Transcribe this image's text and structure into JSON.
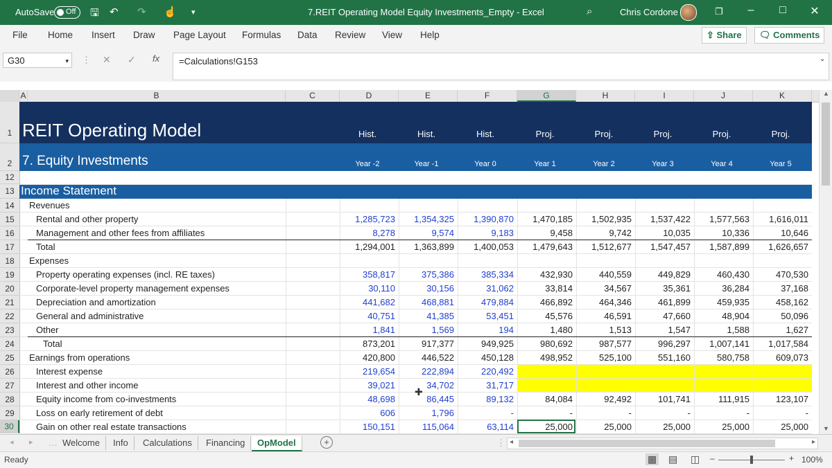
{
  "titlebar": {
    "autosave": "AutoSave",
    "autosave_state": "Off",
    "filename": "7.REIT Operating Model Equity Investments_Empty  -  Excel",
    "user": "Chris Cordone"
  },
  "ribbon": {
    "tabs": [
      "File",
      "Home",
      "Insert",
      "Draw",
      "Page Layout",
      "Formulas",
      "Data",
      "Review",
      "View",
      "Help"
    ],
    "share": "Share",
    "comments": "Comments"
  },
  "formula_bar": {
    "name_box": "G30",
    "formula": "=Calculations!G153",
    "fx": "fx"
  },
  "columns": [
    "A",
    "B",
    "C",
    "D",
    "E",
    "F",
    "G",
    "H",
    "I",
    "J",
    "K"
  ],
  "row_numbers": [
    "1",
    "2",
    "12",
    "13",
    "14",
    "15",
    "16",
    "17",
    "18",
    "19",
    "20",
    "21",
    "22",
    "23",
    "24",
    "25",
    "26",
    "27",
    "28",
    "29",
    "30"
  ],
  "sheet": {
    "title": "REIT Operating Model",
    "subtitle": "7. Equity Investments",
    "section": "Income Statement",
    "period_types": [
      "Hist.",
      "Hist.",
      "Hist.",
      "Proj.",
      "Proj.",
      "Proj.",
      "Proj.",
      "Proj."
    ],
    "periods": [
      "Year -2",
      "Year -1",
      "Year 0",
      "Year 1",
      "Year 2",
      "Year 3",
      "Year 4",
      "Year 5"
    ]
  },
  "rows": [
    {
      "label": "Revenues",
      "indent": 0,
      "values": [
        "",
        "",
        "",
        "",
        "",
        "",
        "",
        ""
      ]
    },
    {
      "label": "Rental and other property",
      "indent": 1,
      "values": [
        "1,285,723",
        "1,354,325",
        "1,390,870",
        "1,470,185",
        "1,502,935",
        "1,537,422",
        "1,577,563",
        "1,616,011"
      ]
    },
    {
      "label": "Management and other fees from affiliates",
      "indent": 1,
      "values": [
        "8,278",
        "9,574",
        "9,183",
        "9,458",
        "9,742",
        "10,035",
        "10,336",
        "10,646"
      ]
    },
    {
      "label": "Total",
      "indent": 1,
      "values": [
        "1,294,001",
        "1,363,899",
        "1,400,053",
        "1,479,643",
        "1,512,677",
        "1,547,457",
        "1,587,899",
        "1,626,657"
      ]
    },
    {
      "label": "Expenses",
      "indent": 0,
      "values": [
        "",
        "",
        "",
        "",
        "",
        "",
        "",
        ""
      ]
    },
    {
      "label": "Property operating expenses (incl. RE taxes)",
      "indent": 1,
      "values": [
        "358,817",
        "375,386",
        "385,334",
        "432,930",
        "440,559",
        "449,829",
        "460,430",
        "470,530"
      ]
    },
    {
      "label": "Corporate-level property management expenses",
      "indent": 1,
      "values": [
        "30,110",
        "30,156",
        "31,062",
        "33,814",
        "34,567",
        "35,361",
        "36,284",
        "37,168"
      ]
    },
    {
      "label": "Depreciation and amortization",
      "indent": 1,
      "values": [
        "441,682",
        "468,881",
        "479,884",
        "466,892",
        "464,346",
        "461,899",
        "459,935",
        "458,162"
      ]
    },
    {
      "label": "General and administrative",
      "indent": 1,
      "values": [
        "40,751",
        "41,385",
        "53,451",
        "45,576",
        "46,591",
        "47,660",
        "48,904",
        "50,096"
      ]
    },
    {
      "label": "Other",
      "indent": 1,
      "values": [
        "1,841",
        "1,569",
        "194",
        "1,480",
        "1,513",
        "1,547",
        "1,588",
        "1,627"
      ]
    },
    {
      "label": "Total",
      "indent": 2,
      "values": [
        "873,201",
        "917,377",
        "949,925",
        "980,692",
        "987,577",
        "996,297",
        "1,007,141",
        "1,017,584"
      ]
    },
    {
      "label": "Earnings from operations",
      "indent": 0,
      "values": [
        "420,800",
        "446,522",
        "450,128",
        "498,952",
        "525,100",
        "551,160",
        "580,758",
        "609,073"
      ]
    },
    {
      "label": "Interest expense",
      "indent": 1,
      "values": [
        "219,654",
        "222,894",
        "220,492",
        "",
        "",
        "",
        "",
        ""
      ]
    },
    {
      "label": "Interest and other income",
      "indent": 1,
      "values": [
        "39,021",
        "34,702",
        "31,717",
        "",
        "",
        "",
        "",
        ""
      ]
    },
    {
      "label": "Equity income from co-investments",
      "indent": 1,
      "values": [
        "48,698",
        "86,445",
        "89,132",
        "84,084",
        "92,492",
        "101,741",
        "111,915",
        "123,107"
      ]
    },
    {
      "label": "Loss on early retirement of debt",
      "indent": 1,
      "values": [
        "606",
        "1,796",
        "-",
        "-",
        "-",
        "-",
        "-",
        "-"
      ]
    },
    {
      "label": "Gain on other real estate transactions",
      "indent": 1,
      "values": [
        "150,151",
        "115,064",
        "63,114",
        "25,000",
        "25,000",
        "25,000",
        "25,000",
        "25,000"
      ]
    }
  ],
  "sheet_tabs": [
    "Welcome",
    "Info",
    "Calculations",
    "Financing",
    "OpModel"
  ],
  "active_tab": "OpModel",
  "status": {
    "ready": "Ready",
    "zoom": "100%"
  },
  "colors": {
    "accent": "#217346",
    "navy": "#14305e",
    "blue_band": "#1a5ea2",
    "input_blue": "#1f3fcf",
    "highlight": "#ffff00"
  }
}
